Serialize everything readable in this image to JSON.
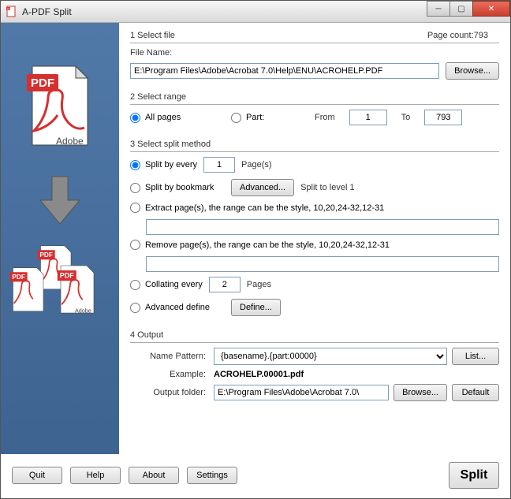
{
  "window": {
    "title": "A-PDF Split"
  },
  "section1": {
    "title": "1 Select file",
    "fileNameLabel": "File Name:",
    "fileName": "E:\\Program Files\\Adobe\\Acrobat 7.0\\Help\\ENU\\ACROHELP.PDF",
    "browse": "Browse...",
    "pageCountLabel": "Page count:",
    "pageCount": "793"
  },
  "section2": {
    "title": "2 Select range",
    "allPages": "All pages",
    "part": "Part:",
    "from": "From",
    "fromVal": "1",
    "to": "To",
    "toVal": "793"
  },
  "section3": {
    "title": "3 Select split method",
    "splitByEvery": "Split by every",
    "splitEveryVal": "1",
    "pages": "Page(s)",
    "splitByBookmark": "Split by bookmark",
    "advanced": "Advanced...",
    "splitToLevel": "Split to level 1",
    "extract": "Extract page(s), the range can be the style, 10,20,24-32,12-31",
    "remove": "Remove page(s), the range can be the style, 10,20,24-32,12-31",
    "collating": "Collating every",
    "collatingVal": "2",
    "pagesLabel": "Pages",
    "advancedDefine": "Advanced define",
    "define": "Define..."
  },
  "section4": {
    "title": "4 Output",
    "namePattern": "Name Pattern:",
    "patternVal": "{basename}.{part:00000}",
    "list": "List...",
    "exampleLabel": "Example:",
    "example": "ACROHELP.00001.pdf",
    "outputFolder": "Output folder:",
    "outputVal": "E:\\Program Files\\Adobe\\Acrobat 7.0\\",
    "browse": "Browse...",
    "default": "Default"
  },
  "footer": {
    "quit": "Quit",
    "help": "Help",
    "about": "About",
    "settings": "Settings",
    "split": "Split"
  }
}
